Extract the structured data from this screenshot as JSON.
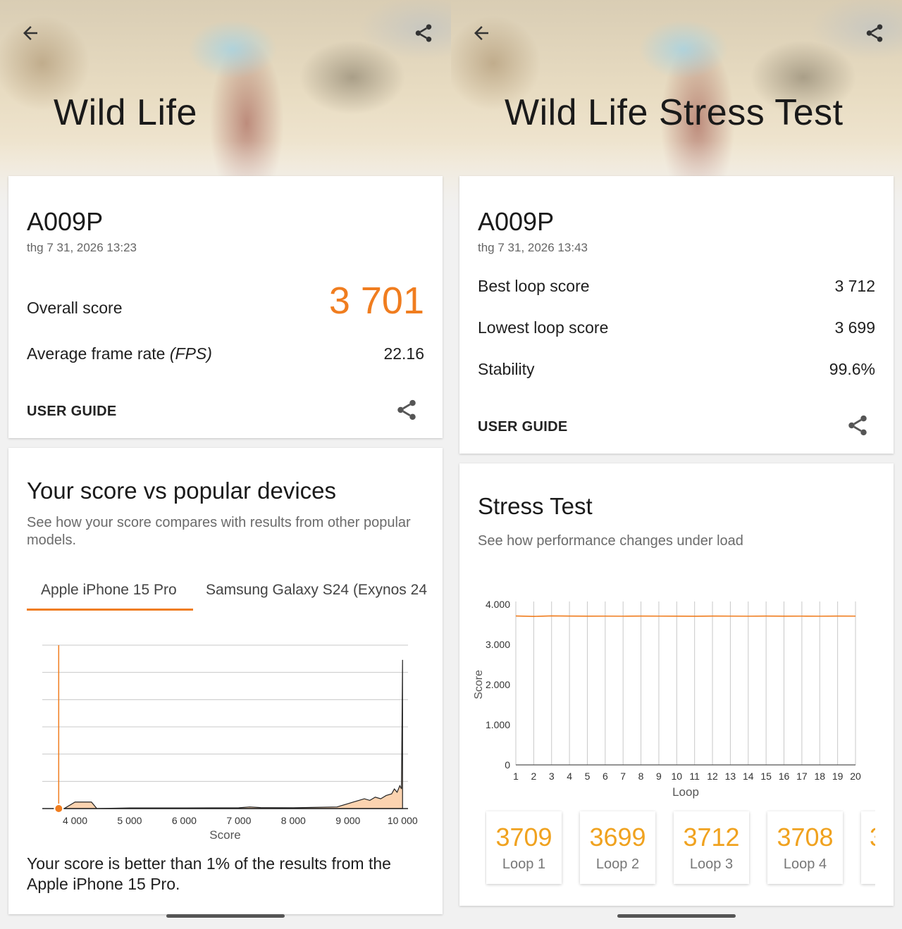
{
  "left": {
    "title": "Wild Life",
    "device": "A009P",
    "date": "thg 7 31, 2026 13:23",
    "overall_label": "Overall score",
    "overall_value": "3 701",
    "fps_label_main": "Average frame rate ",
    "fps_label_unit": "(FPS)",
    "fps_value": "22.16",
    "user_guide": "USER GUIDE",
    "compare_title": "Your score vs popular devices",
    "compare_sub": "See how your score compares with results from other popular models.",
    "tabs": [
      "Apple iPhone 15 Pro",
      "Samsung Galaxy S24 (Exynos 24"
    ],
    "result_text": "Your score is better than 1% of the results from the Apple iPhone 15 Pro."
  },
  "right": {
    "title": "Wild Life Stress Test",
    "device": "A009P",
    "date": "thg 7 31, 2026 13:43",
    "rows": [
      {
        "label": "Best loop score",
        "value": "3 712"
      },
      {
        "label": "Lowest loop score",
        "value": "3 699"
      },
      {
        "label": "Stability",
        "value": "99.6%"
      }
    ],
    "user_guide": "USER GUIDE",
    "stress_title": "Stress Test",
    "stress_sub": "See how performance changes under load",
    "loops": [
      {
        "score": "3709",
        "label": "Loop 1"
      },
      {
        "score": "3699",
        "label": "Loop 2"
      },
      {
        "score": "3712",
        "label": "Loop 3"
      },
      {
        "score": "3708",
        "label": "Loop 4"
      },
      {
        "score": "3",
        "label": ""
      }
    ]
  },
  "colors": {
    "accent": "#f07d1f",
    "loop_accent": "#f0a21f",
    "bar_fill": "#fbd3b0"
  },
  "chart_data": [
    {
      "type": "area",
      "xlabel": "Score",
      "ylabel": "",
      "xlim": [
        3400,
        10100
      ],
      "x_ticks": [
        "4 000",
        "5 000",
        "6 000",
        "7 000",
        "8 000",
        "9 000",
        "10 000"
      ],
      "x_tick_values": [
        4000,
        5000,
        6000,
        7000,
        8000,
        9000,
        10000
      ],
      "marker_score": 3701,
      "ylim": [
        0,
        100
      ],
      "x": [
        3600,
        3800,
        3900,
        4000,
        4100,
        4200,
        4300,
        4400,
        5000,
        6000,
        7000,
        7200,
        7400,
        8000,
        8800,
        9000,
        9100,
        9200,
        9300,
        9400,
        9500,
        9600,
        9700,
        9800,
        9850,
        9900,
        9950,
        9980,
        10000
      ],
      "values": [
        0,
        0,
        2,
        4,
        4,
        4,
        4,
        0,
        0.4,
        0.4,
        0.5,
        1,
        0.6,
        0.5,
        1,
        3,
        4,
        5,
        6,
        5,
        7,
        6,
        8,
        9,
        12,
        10,
        14,
        12,
        91
      ],
      "grid": true
    },
    {
      "type": "line",
      "xlabel": "Loop",
      "ylabel": "Score",
      "x": [
        1,
        2,
        3,
        4,
        5,
        6,
        7,
        8,
        9,
        10,
        11,
        12,
        13,
        14,
        15,
        16,
        17,
        18,
        19,
        20
      ],
      "values": [
        3709,
        3699,
        3712,
        3708,
        3705,
        3706,
        3704,
        3707,
        3706,
        3705,
        3703,
        3708,
        3706,
        3704,
        3707,
        3705,
        3706,
        3704,
        3708,
        3706
      ],
      "xlim": [
        1,
        20
      ],
      "ylim": [
        0,
        4000
      ],
      "y_ticks": [
        "0",
        "1.000",
        "2.000",
        "3.000",
        "4.000"
      ],
      "y_tick_values": [
        0,
        1000,
        2000,
        3000,
        4000
      ],
      "grid": true
    }
  ]
}
